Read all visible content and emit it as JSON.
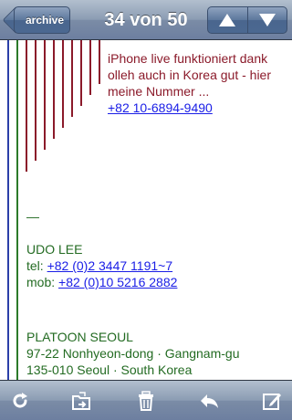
{
  "navbar": {
    "back_label": "archive",
    "title": "34 von 50",
    "prev_icon": "arrow-up-icon",
    "next_icon": "arrow-down-icon"
  },
  "quoted": {
    "line1": "iPhone live funktioniert dank",
    "line2": "olleh auch in Korea gut - hier",
    "line3": "meine Nummer ...",
    "phone_link": "+82 10-6894-9490"
  },
  "signature": {
    "dash": "—",
    "name": "UDO LEE",
    "tel_label": "tel: ",
    "tel_value": "+82 (0)2 3447 1191~7",
    "mob_label": "mob: ",
    "mob_value": "+82 (0)10 5216 2882",
    "company": "PLATOON SEOUL",
    "address1": "97-22 Nonhyeon-dong · Gangnam-gu",
    "address2": "135-010 Seoul · South Korea"
  },
  "toolbar": {
    "icons": [
      "refresh-icon",
      "move-to-folder-icon",
      "trash-icon",
      "reply-icon",
      "compose-icon"
    ]
  },
  "colors": {
    "quote_red": "#8b1a2a",
    "quote_green": "#2c7a2a",
    "quote_blue": "#2b3fa8",
    "link": "#1a1ee6"
  }
}
